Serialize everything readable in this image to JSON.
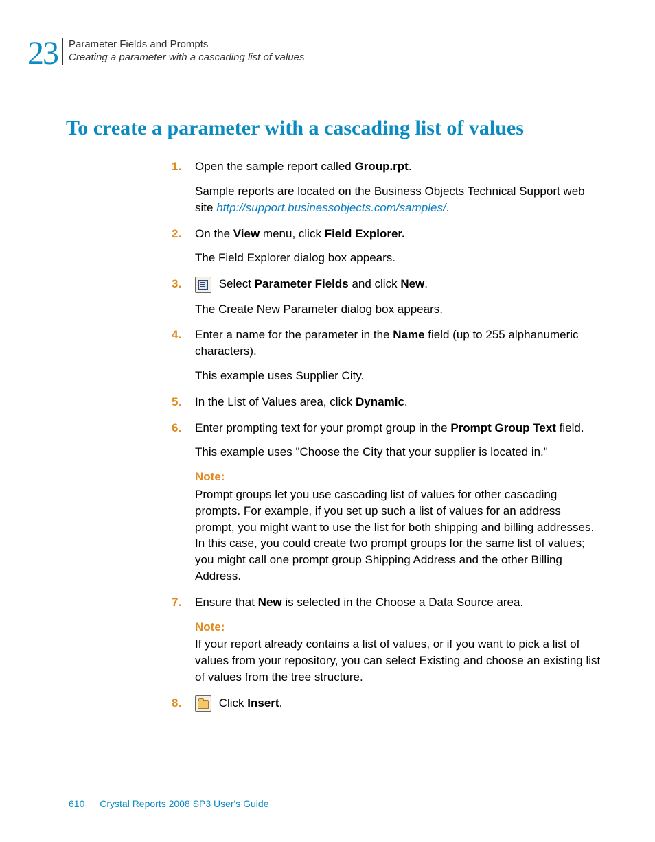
{
  "header": {
    "chapter_number": "23",
    "line1": "Parameter Fields and Prompts",
    "line2": "Creating a parameter with a cascading list of values"
  },
  "section_title": "To create a parameter with a cascading list of values",
  "steps": {
    "s1": {
      "num": "1.",
      "line_pre": "Open the sample report called ",
      "bold1": "Group.rpt",
      "line_post": ".",
      "note_pre": "Sample reports are located on the Business Objects Technical Support web site ",
      "link": "http://support.businessobjects.com/samples/",
      "note_post": "."
    },
    "s2": {
      "num": "2.",
      "pre": "On the ",
      "b1": "View",
      "mid": " menu, click ",
      "b2": "Field Explorer.",
      "result": "The Field Explorer dialog box appears."
    },
    "s3": {
      "num": "3.",
      "pre": " Select ",
      "b1": "Parameter Fields",
      "mid": " and click ",
      "b2": "New",
      "post": ".",
      "result": "The Create New Parameter dialog box appears."
    },
    "s4": {
      "num": "4.",
      "pre": "Enter a name for the parameter in the ",
      "b1": "Name",
      "post": " field (up to 255 alphanumeric characters).",
      "result": "This example uses Supplier City."
    },
    "s5": {
      "num": "5.",
      "pre": "In the List of Values area, click ",
      "b1": "Dynamic",
      "post": "."
    },
    "s6": {
      "num": "6.",
      "pre": "Enter prompting text for your prompt group in the ",
      "b1": "Prompt Group Text",
      "post": " field.",
      "example": "This example uses \"Choose the City that your supplier is located in.\"",
      "note_label": "Note:",
      "note_body": "Prompt groups let you use cascading list of values for other cascading prompts. For example, if you set up such a list of values for an address prompt, you might want to use the list for both shipping and billing addresses. In this case, you could create two prompt groups for the same list of values; you might call one prompt group Shipping Address and the other Billing Address."
    },
    "s7": {
      "num": "7.",
      "pre": "Ensure that ",
      "b1": "New",
      "post": " is selected in the Choose a Data Source area.",
      "note_label": "Note:",
      "note_body": "If your report already contains a list of values, or if you want to pick a list of values from your repository, you can select Existing and choose an existing list of values from the tree structure."
    },
    "s8": {
      "num": "8.",
      "pre": " Click ",
      "b1": "Insert",
      "post": "."
    }
  },
  "footer": {
    "page": "610",
    "doc": "Crystal Reports 2008 SP3 User's Guide"
  }
}
